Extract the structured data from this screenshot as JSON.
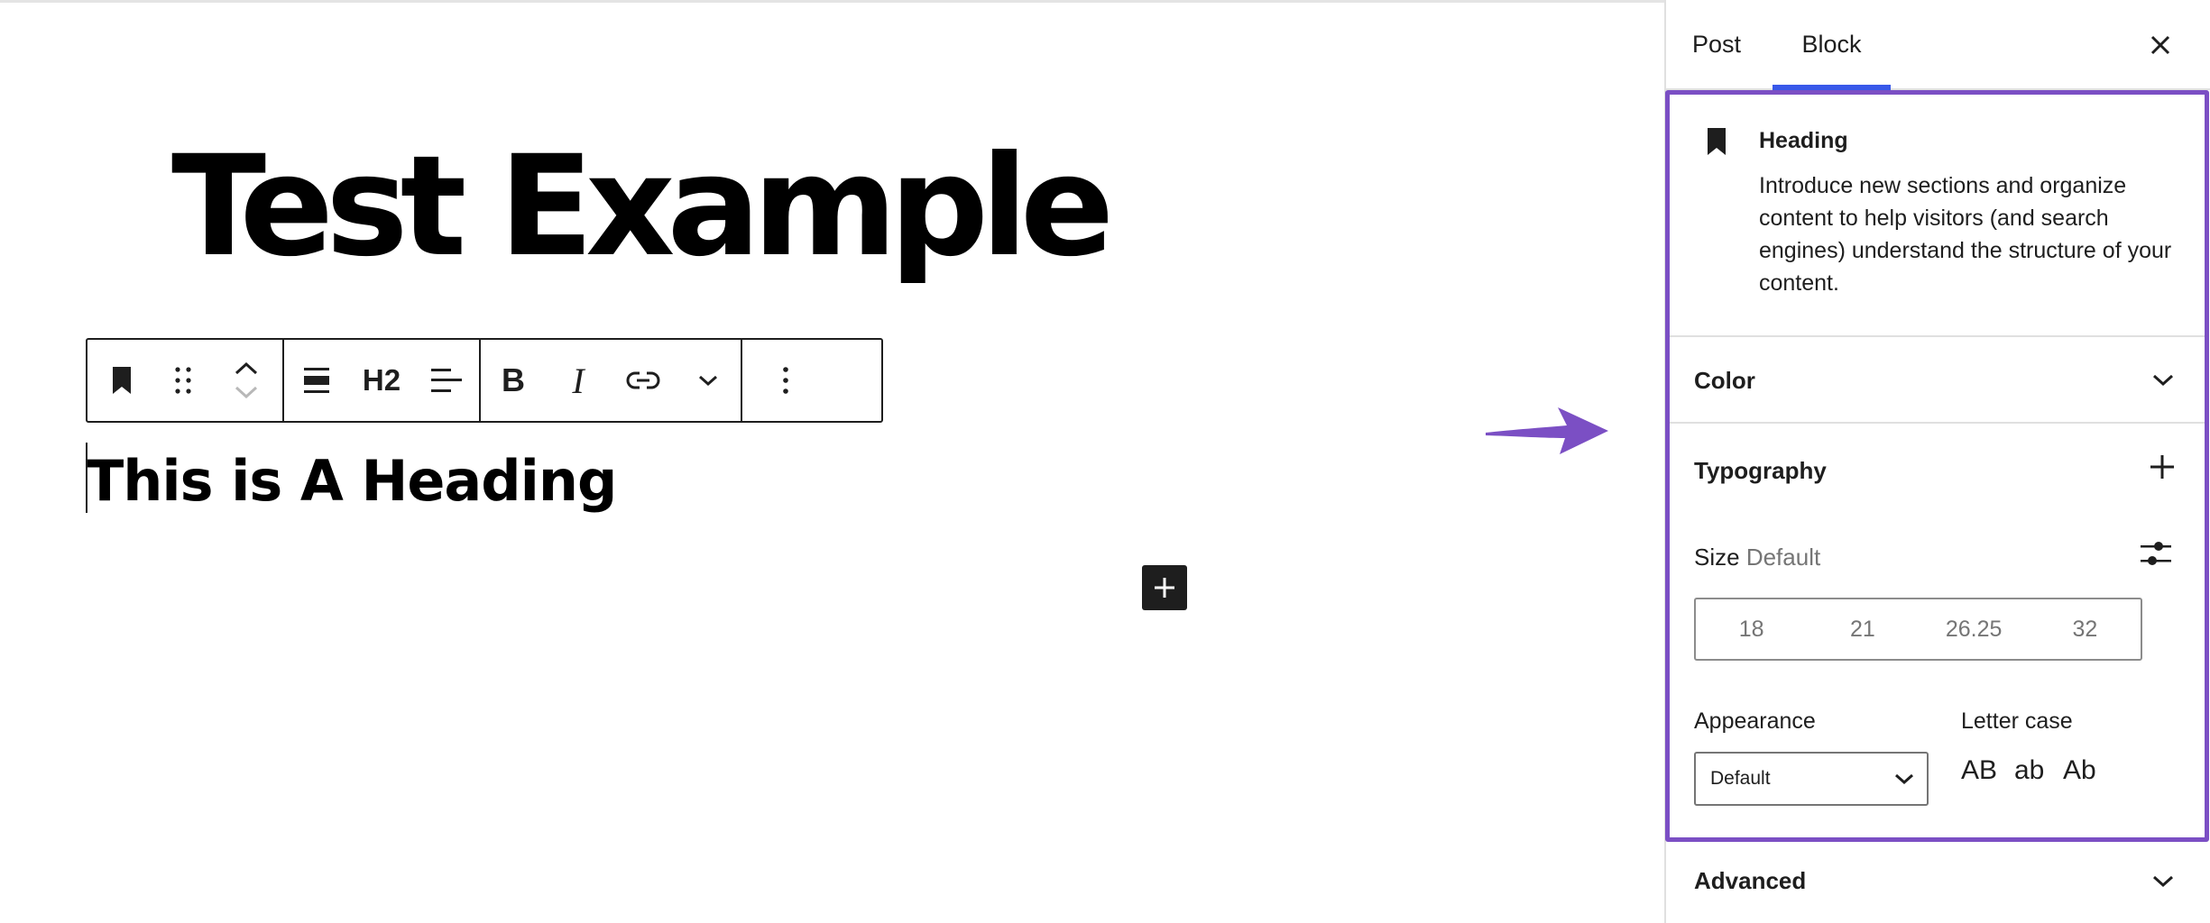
{
  "editor": {
    "post_title": "Test Example",
    "heading_text": "This is A Heading",
    "toolbar": {
      "block_type_icon": "bookmark-icon",
      "drag_icon": "drag-handle-icon",
      "move_up_icon": "chevron-up-icon",
      "move_down_icon": "chevron-down-icon",
      "align_icon": "align-none-icon",
      "heading_level_label": "H2",
      "text_align_icon": "align-left-icon",
      "bold_label": "B",
      "italic_label": "I",
      "link_icon": "link-icon",
      "more_icon": "chevron-down-icon",
      "options_icon": "vertical-ellipsis-icon"
    },
    "inserter_icon": "plus-icon"
  },
  "sidebar": {
    "tabs": [
      {
        "label": "Post",
        "active": false
      },
      {
        "label": "Block",
        "active": true
      }
    ],
    "close_icon": "close-icon",
    "block_card": {
      "icon": "bookmark-icon",
      "title": "Heading",
      "description": "Introduce new sections and organize content to help visitors (and search engines) understand the structure of your content."
    },
    "panels": {
      "color": {
        "title": "Color",
        "icon": "chevron-down-icon"
      },
      "typography": {
        "title": "Typography",
        "icon": "plus-icon",
        "size_label": "Size",
        "size_value": "Default",
        "size_options": [
          "18",
          "21",
          "26.25",
          "32"
        ],
        "custom_size_icon": "sliders-icon",
        "appearance_label": "Appearance",
        "appearance_value": "Default",
        "letter_case_label": "Letter case",
        "letter_case_options": [
          "AB",
          "ab",
          "Ab"
        ]
      },
      "advanced": {
        "title": "Advanced",
        "icon": "chevron-down-icon"
      }
    }
  },
  "colors": {
    "accent": "#3858e9",
    "highlight": "#7b4fc4",
    "text": "#1e1e1e",
    "muted": "#757575"
  }
}
